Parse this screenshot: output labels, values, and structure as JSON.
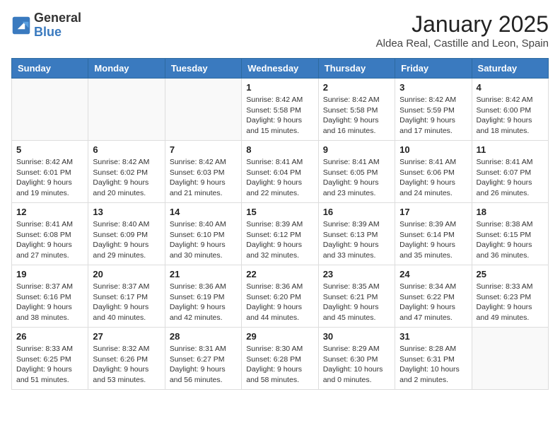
{
  "logo": {
    "general": "General",
    "blue": "Blue"
  },
  "header": {
    "month": "January 2025",
    "location": "Aldea Real, Castille and Leon, Spain"
  },
  "weekdays": [
    "Sunday",
    "Monday",
    "Tuesday",
    "Wednesday",
    "Thursday",
    "Friday",
    "Saturday"
  ],
  "weeks": [
    [
      {
        "day": "",
        "detail": ""
      },
      {
        "day": "",
        "detail": ""
      },
      {
        "day": "",
        "detail": ""
      },
      {
        "day": "1",
        "detail": "Sunrise: 8:42 AM\nSunset: 5:58 PM\nDaylight: 9 hours and 15 minutes."
      },
      {
        "day": "2",
        "detail": "Sunrise: 8:42 AM\nSunset: 5:58 PM\nDaylight: 9 hours and 16 minutes."
      },
      {
        "day": "3",
        "detail": "Sunrise: 8:42 AM\nSunset: 5:59 PM\nDaylight: 9 hours and 17 minutes."
      },
      {
        "day": "4",
        "detail": "Sunrise: 8:42 AM\nSunset: 6:00 PM\nDaylight: 9 hours and 18 minutes."
      }
    ],
    [
      {
        "day": "5",
        "detail": "Sunrise: 8:42 AM\nSunset: 6:01 PM\nDaylight: 9 hours and 19 minutes."
      },
      {
        "day": "6",
        "detail": "Sunrise: 8:42 AM\nSunset: 6:02 PM\nDaylight: 9 hours and 20 minutes."
      },
      {
        "day": "7",
        "detail": "Sunrise: 8:42 AM\nSunset: 6:03 PM\nDaylight: 9 hours and 21 minutes."
      },
      {
        "day": "8",
        "detail": "Sunrise: 8:41 AM\nSunset: 6:04 PM\nDaylight: 9 hours and 22 minutes."
      },
      {
        "day": "9",
        "detail": "Sunrise: 8:41 AM\nSunset: 6:05 PM\nDaylight: 9 hours and 23 minutes."
      },
      {
        "day": "10",
        "detail": "Sunrise: 8:41 AM\nSunset: 6:06 PM\nDaylight: 9 hours and 24 minutes."
      },
      {
        "day": "11",
        "detail": "Sunrise: 8:41 AM\nSunset: 6:07 PM\nDaylight: 9 hours and 26 minutes."
      }
    ],
    [
      {
        "day": "12",
        "detail": "Sunrise: 8:41 AM\nSunset: 6:08 PM\nDaylight: 9 hours and 27 minutes."
      },
      {
        "day": "13",
        "detail": "Sunrise: 8:40 AM\nSunset: 6:09 PM\nDaylight: 9 hours and 29 minutes."
      },
      {
        "day": "14",
        "detail": "Sunrise: 8:40 AM\nSunset: 6:10 PM\nDaylight: 9 hours and 30 minutes."
      },
      {
        "day": "15",
        "detail": "Sunrise: 8:39 AM\nSunset: 6:12 PM\nDaylight: 9 hours and 32 minutes."
      },
      {
        "day": "16",
        "detail": "Sunrise: 8:39 AM\nSunset: 6:13 PM\nDaylight: 9 hours and 33 minutes."
      },
      {
        "day": "17",
        "detail": "Sunrise: 8:39 AM\nSunset: 6:14 PM\nDaylight: 9 hours and 35 minutes."
      },
      {
        "day": "18",
        "detail": "Sunrise: 8:38 AM\nSunset: 6:15 PM\nDaylight: 9 hours and 36 minutes."
      }
    ],
    [
      {
        "day": "19",
        "detail": "Sunrise: 8:37 AM\nSunset: 6:16 PM\nDaylight: 9 hours and 38 minutes."
      },
      {
        "day": "20",
        "detail": "Sunrise: 8:37 AM\nSunset: 6:17 PM\nDaylight: 9 hours and 40 minutes."
      },
      {
        "day": "21",
        "detail": "Sunrise: 8:36 AM\nSunset: 6:19 PM\nDaylight: 9 hours and 42 minutes."
      },
      {
        "day": "22",
        "detail": "Sunrise: 8:36 AM\nSunset: 6:20 PM\nDaylight: 9 hours and 44 minutes."
      },
      {
        "day": "23",
        "detail": "Sunrise: 8:35 AM\nSunset: 6:21 PM\nDaylight: 9 hours and 45 minutes."
      },
      {
        "day": "24",
        "detail": "Sunrise: 8:34 AM\nSunset: 6:22 PM\nDaylight: 9 hours and 47 minutes."
      },
      {
        "day": "25",
        "detail": "Sunrise: 8:33 AM\nSunset: 6:23 PM\nDaylight: 9 hours and 49 minutes."
      }
    ],
    [
      {
        "day": "26",
        "detail": "Sunrise: 8:33 AM\nSunset: 6:25 PM\nDaylight: 9 hours and 51 minutes."
      },
      {
        "day": "27",
        "detail": "Sunrise: 8:32 AM\nSunset: 6:26 PM\nDaylight: 9 hours and 53 minutes."
      },
      {
        "day": "28",
        "detail": "Sunrise: 8:31 AM\nSunset: 6:27 PM\nDaylight: 9 hours and 56 minutes."
      },
      {
        "day": "29",
        "detail": "Sunrise: 8:30 AM\nSunset: 6:28 PM\nDaylight: 9 hours and 58 minutes."
      },
      {
        "day": "30",
        "detail": "Sunrise: 8:29 AM\nSunset: 6:30 PM\nDaylight: 10 hours and 0 minutes."
      },
      {
        "day": "31",
        "detail": "Sunrise: 8:28 AM\nSunset: 6:31 PM\nDaylight: 10 hours and 2 minutes."
      },
      {
        "day": "",
        "detail": ""
      }
    ]
  ]
}
